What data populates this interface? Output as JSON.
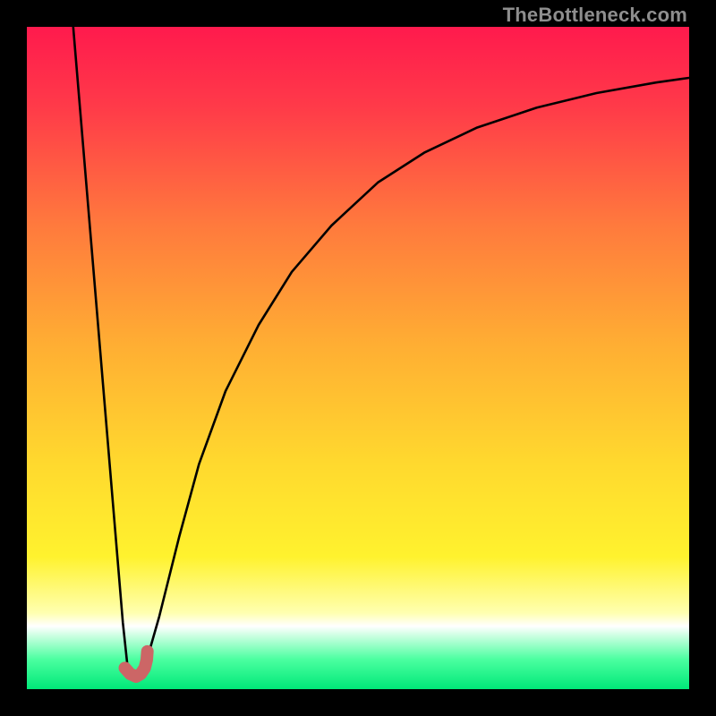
{
  "watermark": "TheBottleneck.com",
  "gradient_stops": [
    {
      "offset": 0.0,
      "color": "#ff1a4d"
    },
    {
      "offset": 0.12,
      "color": "#ff3a49"
    },
    {
      "offset": 0.3,
      "color": "#ff7a3d"
    },
    {
      "offset": 0.48,
      "color": "#ffae33"
    },
    {
      "offset": 0.66,
      "color": "#ffd92e"
    },
    {
      "offset": 0.8,
      "color": "#fff22e"
    },
    {
      "offset": 0.885,
      "color": "#ffffb0"
    },
    {
      "offset": 0.905,
      "color": "#ffffff"
    },
    {
      "offset": 0.92,
      "color": "#c9ffe0"
    },
    {
      "offset": 0.955,
      "color": "#4bffa0"
    },
    {
      "offset": 1.0,
      "color": "#00e878"
    }
  ],
  "chart_data": {
    "type": "line",
    "title": "",
    "xlabel": "",
    "ylabel": "",
    "xlim": [
      0,
      100
    ],
    "ylim": [
      0,
      100
    ],
    "grid": false,
    "series": [
      {
        "name": "left-branch",
        "x": [
          7.0,
          8.5,
          10.0,
          11.5,
          13.0,
          14.5,
          15.3
        ],
        "values": [
          100.0,
          82.0,
          64.0,
          46.0,
          28.0,
          10.0,
          2.5
        ]
      },
      {
        "name": "right-branch",
        "x": [
          18.0,
          20.0,
          23.0,
          26.0,
          30.0,
          35.0,
          40.0,
          46.0,
          53.0,
          60.0,
          68.0,
          77.0,
          86.0,
          95.0,
          100.0
        ],
        "values": [
          4.0,
          11.0,
          23.0,
          34.0,
          45.0,
          55.0,
          63.0,
          70.0,
          76.5,
          81.0,
          84.8,
          87.8,
          90.0,
          91.6,
          92.3
        ]
      }
    ],
    "marker": {
      "name": "optimal-point",
      "color": "#cc6666",
      "points_xy": [
        [
          14.8,
          3.2
        ],
        [
          15.6,
          2.3
        ],
        [
          16.5,
          1.9
        ],
        [
          17.2,
          2.3
        ],
        [
          17.8,
          3.2
        ],
        [
          18.1,
          4.4
        ],
        [
          18.2,
          5.7
        ]
      ]
    }
  }
}
